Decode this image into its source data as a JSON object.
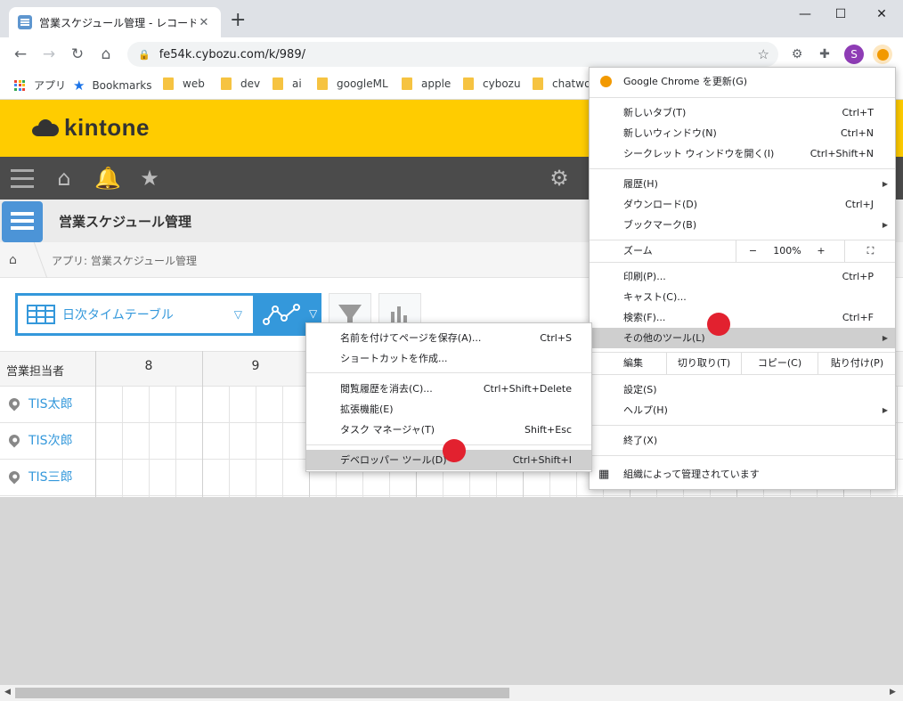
{
  "browser": {
    "tab_title": "営業スケジュール管理 - レコードの一覧",
    "new_tab": "+",
    "window_controls": {
      "minimize": "—",
      "maximize": "☐",
      "close": "✕"
    },
    "url": "fe54k.cybozu.com/k/989/",
    "profile_initial": "S"
  },
  "bookmarks": [
    {
      "label": "アプリ",
      "type": "apps"
    },
    {
      "label": "Bookmarks",
      "type": "star"
    },
    {
      "label": "web",
      "type": "folder"
    },
    {
      "label": "dev",
      "type": "folder"
    },
    {
      "label": "ai",
      "type": "folder"
    },
    {
      "label": "googleML",
      "type": "folder"
    },
    {
      "label": "apple",
      "type": "folder"
    },
    {
      "label": "cybozu",
      "type": "folder"
    },
    {
      "label": "chatwor",
      "type": "folder"
    }
  ],
  "kintone": {
    "logo_text": "kintone",
    "app_name": "営業スケジュール管理",
    "breadcrumb": "アプリ: 営業スケジュール管理",
    "view_name": "日次タイムテーブル",
    "grid_header": "営業担当者",
    "hours": [
      "8",
      "9"
    ],
    "rows": [
      "TIS太郎",
      "TIS次郎",
      "TIS三郎"
    ]
  },
  "chrome_menu": {
    "update": "Google Chrome を更新(G)",
    "new_tab": {
      "label": "新しいタブ(T)",
      "shortcut": "Ctrl+T"
    },
    "new_window": {
      "label": "新しいウィンドウ(N)",
      "shortcut": "Ctrl+N"
    },
    "incognito": {
      "label": "シークレット ウィンドウを開く(I)",
      "shortcut": "Ctrl+Shift+N"
    },
    "history": "履歴(H)",
    "downloads": {
      "label": "ダウンロード(D)",
      "shortcut": "Ctrl+J"
    },
    "bookmarks": "ブックマーク(B)",
    "zoom": {
      "label": "ズーム",
      "minus": "−",
      "value": "100%",
      "plus": "+"
    },
    "print": {
      "label": "印刷(P)...",
      "shortcut": "Ctrl+P"
    },
    "cast": "キャスト(C)...",
    "find": {
      "label": "検索(F)...",
      "shortcut": "Ctrl+F"
    },
    "more_tools": "その他のツール(L)",
    "edit": {
      "label": "編集",
      "cut": "切り取り(T)",
      "copy": "コピー(C)",
      "paste": "貼り付け(P)"
    },
    "settings": "設定(S)",
    "help": "ヘルプ(H)",
    "exit": "終了(X)",
    "managed": "組織によって管理されています"
  },
  "tools_submenu": {
    "save_page": {
      "label": "名前を付けてページを保存(A)...",
      "shortcut": "Ctrl+S"
    },
    "create_shortcut": "ショートカットを作成...",
    "clear_data": {
      "label": "閲覧履歴を消去(C)...",
      "shortcut": "Ctrl+Shift+Delete"
    },
    "extensions": "拡張機能(E)",
    "task_manager": {
      "label": "タスク マネージャ(T)",
      "shortcut": "Shift+Esc"
    },
    "dev_tools": {
      "label": "デベロッパー ツール(D)",
      "shortcut": "Ctrl+Shift+I"
    }
  },
  "colors": {
    "kintone_yellow": "#ffcc00",
    "kintone_blue": "#3498db",
    "marker_red": "#e2212f"
  }
}
